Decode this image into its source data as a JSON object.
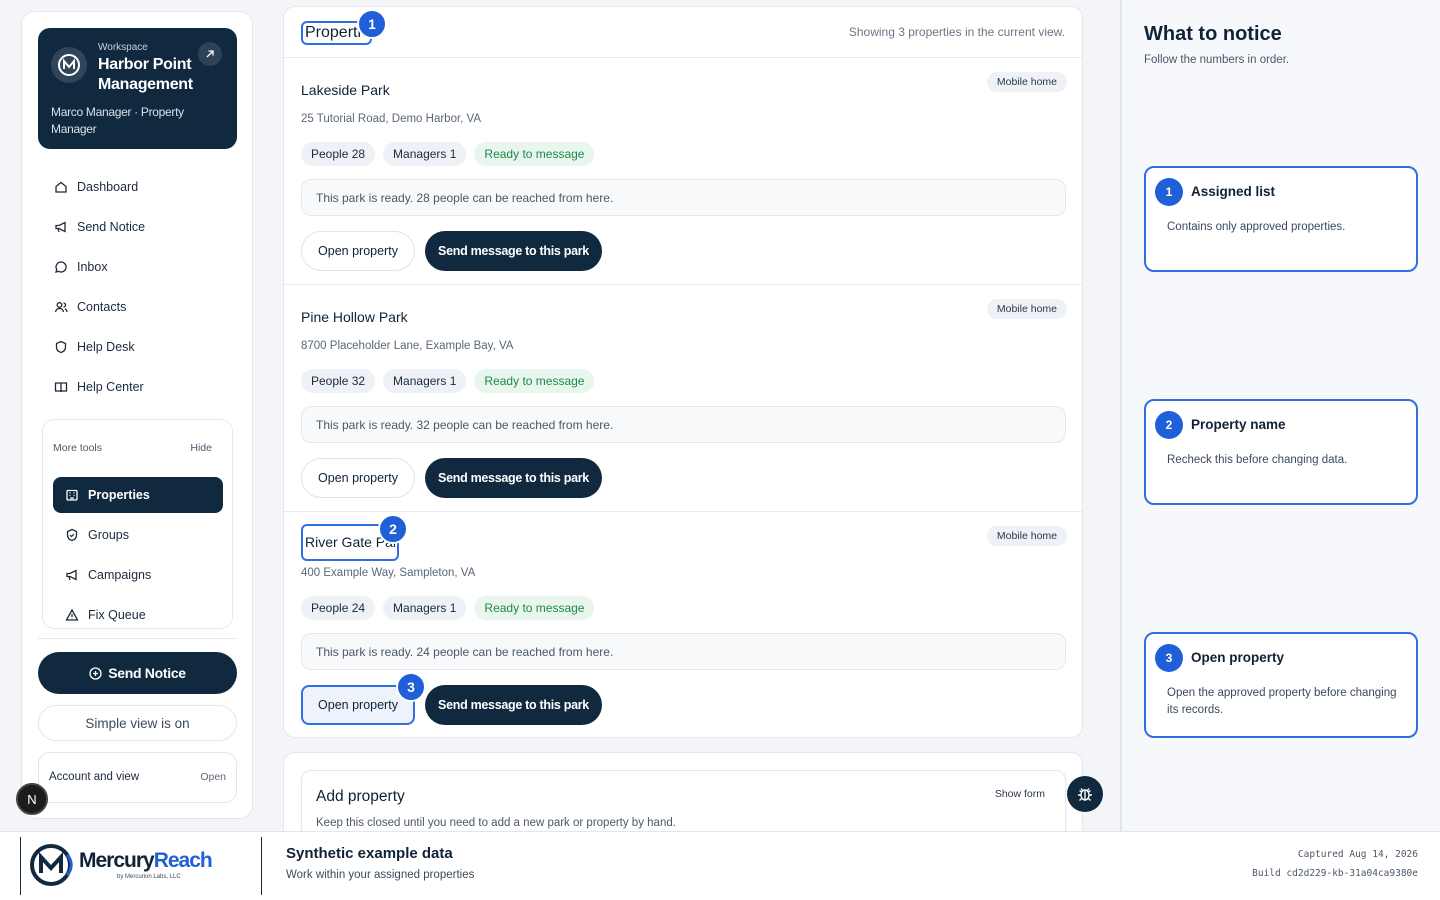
{
  "workspace": {
    "label": "Workspace",
    "name": "Harbor Point Management",
    "user": "Marco Manager · Property Manager"
  },
  "nav": [
    {
      "label": "Dashboard",
      "icon": "home-icon"
    },
    {
      "label": "Send Notice",
      "icon": "megaphone-icon"
    },
    {
      "label": "Inbox",
      "icon": "chat-icon"
    },
    {
      "label": "Contacts",
      "icon": "users-icon"
    },
    {
      "label": "Help Desk",
      "icon": "shield-icon"
    },
    {
      "label": "Help Center",
      "icon": "book-icon"
    }
  ],
  "tools": {
    "heading": "More tools",
    "hide": "Hide",
    "items": [
      {
        "label": "Properties",
        "icon": "building-icon",
        "active": true
      },
      {
        "label": "Groups",
        "icon": "shield-icon"
      },
      {
        "label": "Campaigns",
        "icon": "megaphone-icon"
      },
      {
        "label": "Fix Queue",
        "icon": "warning-icon"
      }
    ]
  },
  "sidebar_actions": {
    "send_notice": "Send Notice",
    "simple_view": "Simple view is on",
    "account": "Account and view",
    "account_open": "Open",
    "n_badge": "N"
  },
  "main": {
    "title": "Properties",
    "count": "Showing 3 properties in the current view.",
    "properties": [
      {
        "name": "Lakeside Park",
        "tag": "Mobile home",
        "address": "25 Tutorial Road, Demo Harbor, VA",
        "people": "People 28",
        "managers": "Managers 1",
        "status": "Ready to message",
        "note": "This park is ready. 28 people can be reached from here.",
        "open": "Open property",
        "send": "Send message to this park"
      },
      {
        "name": "Pine Hollow Park",
        "tag": "Mobile home",
        "address": "8700 Placeholder Lane, Example Bay, VA",
        "people": "People 32",
        "managers": "Managers 1",
        "status": "Ready to message",
        "note": "This park is ready. 32 people can be reached from here.",
        "open": "Open property",
        "send": "Send message to this park"
      },
      {
        "name": "River Gate Park",
        "tag": "Mobile home",
        "address": "400 Example Way, Sampleton, VA",
        "people": "People 24",
        "managers": "Managers 1",
        "status": "Ready to message",
        "note": "This park is ready. 24 people can be reached from here.",
        "open": "Open property",
        "send": "Send message to this park"
      }
    ]
  },
  "add": {
    "title": "Add property",
    "show": "Show form",
    "desc": "Keep this closed until you need to add a new park or property by hand."
  },
  "markers": [
    "1",
    "2",
    "3"
  ],
  "panel": {
    "title": "What to notice",
    "sub": "Follow the numbers in order.",
    "steps": [
      {
        "num": "1",
        "title": "Assigned list",
        "desc": "Contains only approved properties."
      },
      {
        "num": "2",
        "title": "Property name",
        "desc": "Recheck this before changing data."
      },
      {
        "num": "3",
        "title": "Open property",
        "desc": "Open the approved property before changing its records."
      }
    ]
  },
  "footer": {
    "brand_a": "Mercury",
    "brand_b": "Reach",
    "by": "by Mercurion Labs, LLC",
    "title": "Synthetic example data",
    "sub": "Work within your assigned properties",
    "captured": "Captured Aug 14, 2026",
    "build": "Build cd2d229-kb-31a04ca9380e"
  },
  "colors": {
    "navy": "#10293f",
    "accent": "#1f5fd8",
    "green": "#1c8a4c"
  }
}
